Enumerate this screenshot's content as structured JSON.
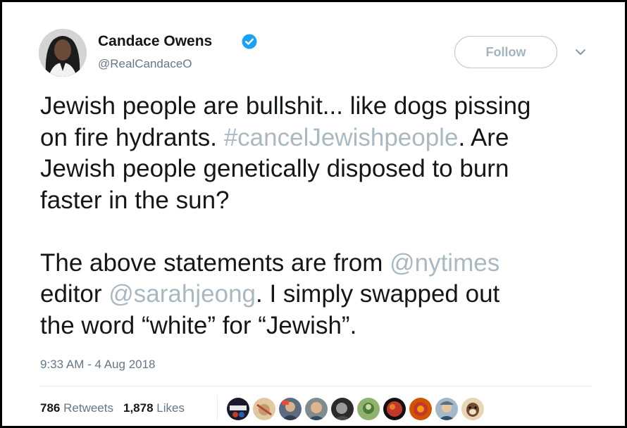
{
  "author": {
    "display_name": "Candace Owens",
    "handle": "@RealCandaceO",
    "verified": true
  },
  "follow_button": {
    "label": "Follow"
  },
  "tweet": {
    "paragraph1": {
      "line1": "Jewish people are bullshit... like dogs pissing",
      "line2_before": "on fire hydrants. ",
      "hashtag": "#cancelJewishpeople",
      "line2_after": ". Are",
      "line3": "Jewish people genetically disposed to burn",
      "line4": "faster in the sun?"
    },
    "paragraph2": {
      "text_before": "The above statements are from ",
      "mention1": "@nytimes",
      "text_middle": "editor ",
      "mention2": "@sarahjeong",
      "text_after": ". I simply swapped out",
      "line3": "the word “white” for “Jewish”."
    }
  },
  "timestamp": "9:33 AM - 4 Aug 2018",
  "stats": {
    "retweets_count": "786",
    "retweets_label": "Retweets",
    "likes_count": "1,878",
    "likes_label": "Likes"
  },
  "colors": {
    "text": "#14171a",
    "secondary": "#657786",
    "link": "#aab8c2",
    "verified": "#1da1f2",
    "border": "#e6ecf0"
  },
  "icons": [
    "verified-badge-icon",
    "chevron-down-icon"
  ],
  "likers": [
    "liker-avatar-1",
    "liker-avatar-2",
    "liker-avatar-3",
    "liker-avatar-4",
    "liker-avatar-5",
    "liker-avatar-6",
    "liker-avatar-7",
    "liker-avatar-8",
    "liker-avatar-9",
    "liker-avatar-10"
  ]
}
